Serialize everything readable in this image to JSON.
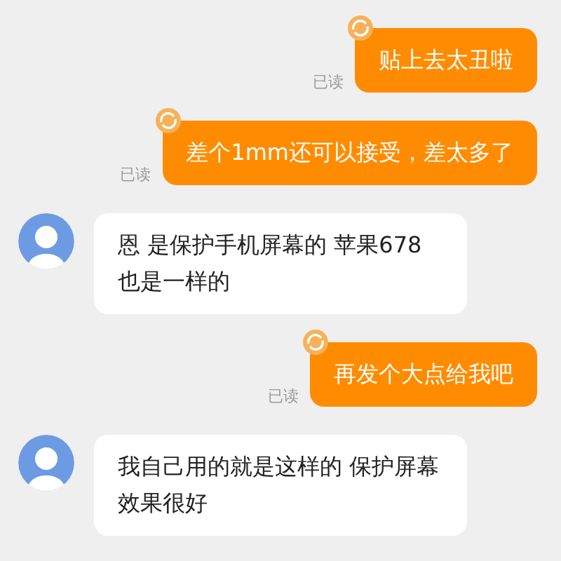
{
  "messages": [
    {
      "kind": "outgoing",
      "text": "贴上去太丑啦",
      "read_label": "已读"
    },
    {
      "kind": "outgoing",
      "text": "差个1mm还可以接受，差太多了",
      "read_label": "已读"
    },
    {
      "kind": "incoming",
      "text": "恩 是保护手机屏幕的 苹果678也是一样的"
    },
    {
      "kind": "outgoing",
      "text": "再发个大点给我吧",
      "read_label": "已读"
    },
    {
      "kind": "incoming",
      "text": "我自己用的就是这样的 保护屏幕效果很好"
    }
  ]
}
